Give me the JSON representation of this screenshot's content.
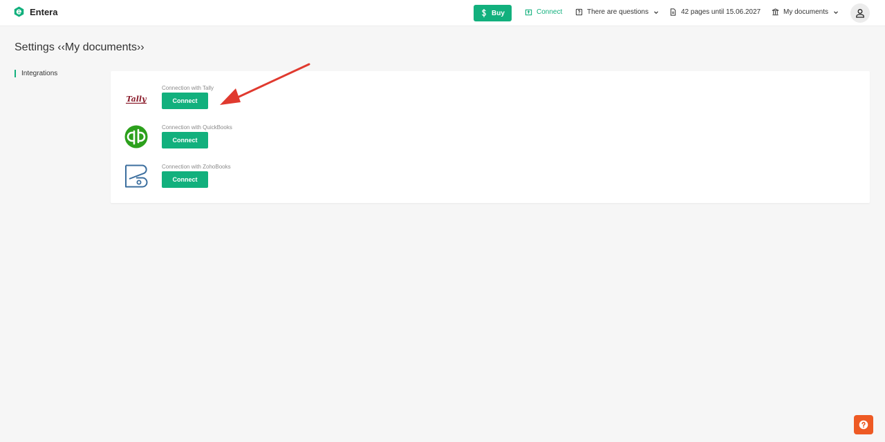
{
  "header": {
    "brand": "Entera",
    "buy_label": "Buy",
    "connect_label": "Connect",
    "questions_label": "There are questions",
    "pages_label": "42 pages until 15.06.2027",
    "mydocs_label": "My documents"
  },
  "page": {
    "title": "Settings ‹‹My documents››"
  },
  "sidebar": {
    "items": [
      {
        "label": "Integrations"
      }
    ]
  },
  "integrations": [
    {
      "name": "Tally",
      "logo_icon": "tally-logo",
      "label": "Connection with Tally",
      "button": "Connect"
    },
    {
      "name": "QuickBooks",
      "logo_icon": "quickbooks-logo",
      "label": "Connection with QuickBooks",
      "button": "Connect"
    },
    {
      "name": "ZohoBooks",
      "logo_icon": "zohobooks-logo",
      "label": "Connection with ZohoBooks",
      "button": "Connect"
    }
  ],
  "tally_logo_text": "Tally",
  "colors": {
    "accent": "#12b07d",
    "help": "#ee5a24",
    "annotation_arrow": "#e03a2f",
    "quickbooks": "#2ca01c",
    "zoho": "#3b6e9e"
  }
}
